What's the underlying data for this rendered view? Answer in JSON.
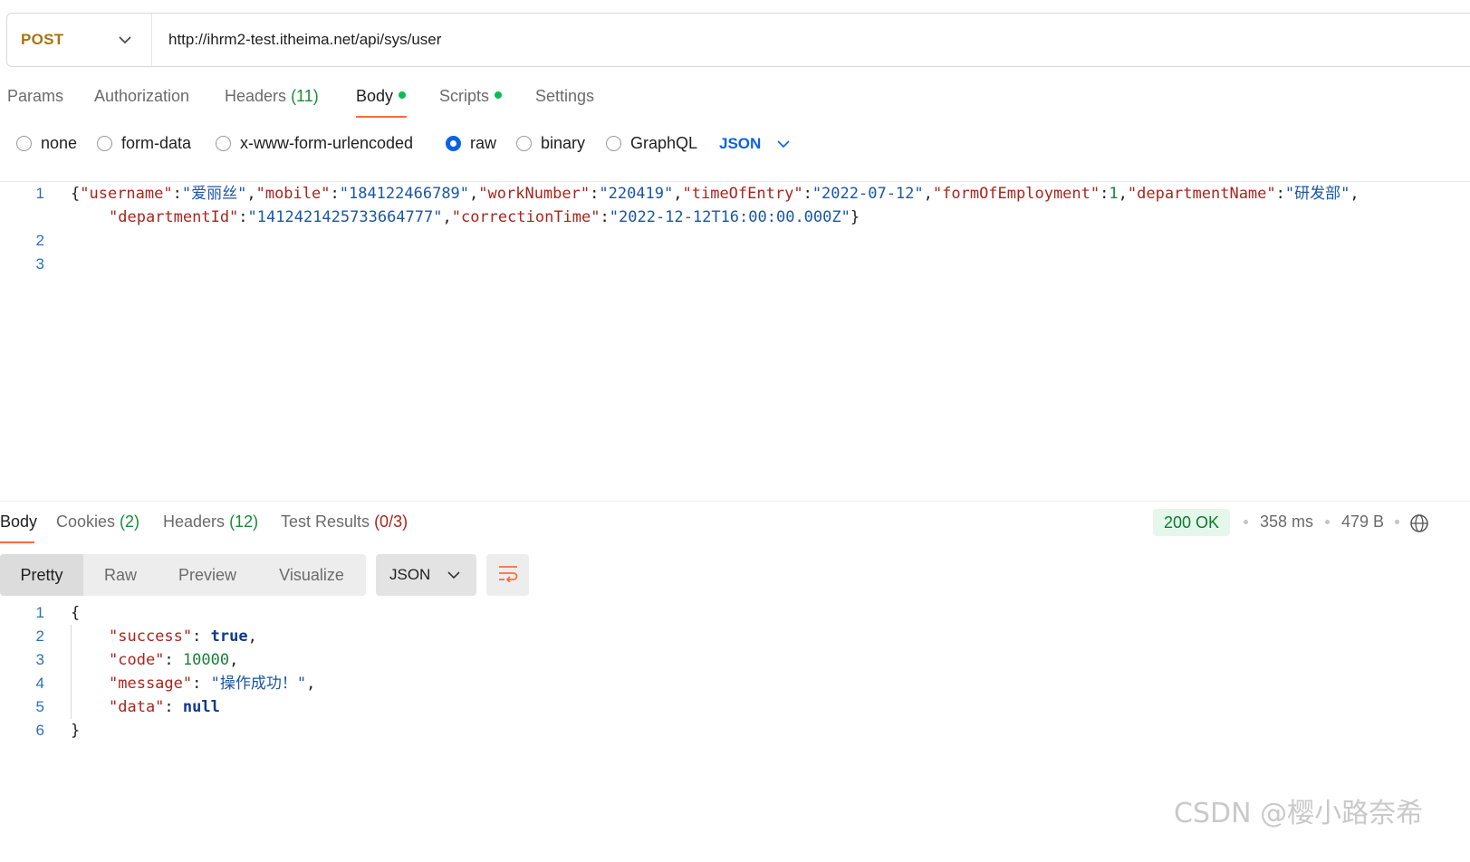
{
  "request": {
    "method": "POST",
    "url": "http://ihrm2-test.itheima.net/api/sys/user"
  },
  "request_tabs": [
    {
      "label": "Params"
    },
    {
      "label": "Authorization"
    },
    {
      "label": "Headers",
      "count": "(11)"
    },
    {
      "label": "Body",
      "dot": true,
      "active": true
    },
    {
      "label": "Scripts",
      "dot": true
    },
    {
      "label": "Settings"
    }
  ],
  "body_types": [
    {
      "label": "none",
      "checked": false
    },
    {
      "label": "form-data",
      "checked": false
    },
    {
      "label": "x-www-form-urlencoded",
      "checked": false
    },
    {
      "label": "raw",
      "checked": true
    },
    {
      "label": "binary",
      "checked": false
    },
    {
      "label": "GraphQL",
      "checked": false
    }
  ],
  "body_language": "JSON",
  "request_body": {
    "line_numbers": [
      "1",
      "2",
      "3"
    ],
    "line1": {
      "username_key": "\"username\"",
      "username_val": "\"爱丽丝\"",
      "mobile_key": "\"mobile\"",
      "mobile_val": "\"184122466789\"",
      "workNumber_key": "\"workNumber\"",
      "workNumber_val": "\"220419\"",
      "timeOfEntry_key": "\"timeOfEntry\"",
      "timeOfEntry_val": "\"2022-07-12\"",
      "formOfEmployment_key": "\"formOfEmployment\"",
      "formOfEmployment_val": "1",
      "departmentName_key": "\"departmentName\"",
      "departmentName_val": "\"研发部\""
    },
    "line1_wrap": {
      "departmentId_key": "\"departmentId\"",
      "departmentId_val": "\"1412421425733664777\"",
      "correctionTime_key": "\"correctionTime\"",
      "correctionTime_val": "\"2022-12-12T16:00:00.000Z\""
    }
  },
  "response_tabs": [
    {
      "label": "Body",
      "active": true
    },
    {
      "label": "Cookies",
      "count": "(2)"
    },
    {
      "label": "Headers",
      "count": "(12)"
    },
    {
      "label": "Test Results",
      "count": "(0/3)"
    }
  ],
  "response_meta": {
    "status": "200 OK",
    "time": "358 ms",
    "size": "479 B"
  },
  "view_modes": [
    "Pretty",
    "Raw",
    "Preview",
    "Visualize"
  ],
  "response_format": "JSON",
  "response_body": {
    "line_numbers": [
      "1",
      "2",
      "3",
      "4",
      "5",
      "6"
    ],
    "open_brace": "{",
    "close_brace": "}",
    "success_key": "\"success\"",
    "success_val": "true",
    "code_key": "\"code\"",
    "code_val": "10000",
    "message_key": "\"message\"",
    "message_val": "\"操作成功！\"",
    "data_key": "\"data\"",
    "data_val": "null"
  },
  "watermark": "CSDN @樱小路奈希"
}
